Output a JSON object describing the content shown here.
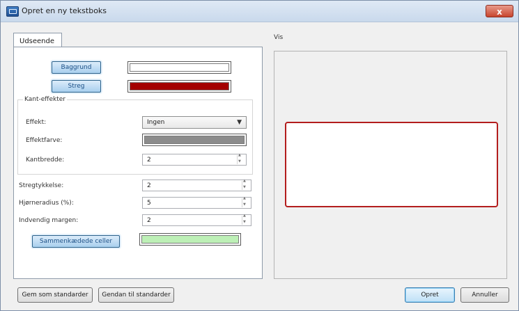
{
  "window": {
    "title": "Opret en ny tekstboks",
    "close_label": "x"
  },
  "tabs": {
    "appearance_label": "Udseende"
  },
  "appearance": {
    "background_button": "Baggrund",
    "stroke_button": "Streg",
    "background_color": "#ffffff",
    "stroke_color": "#a40000",
    "edge_effects": {
      "group_label": "Kant-effekter",
      "effect_label": "Effekt:",
      "effect_value": "Ingen",
      "effect_color_label": "Effektfarve:",
      "effect_color": "#8c8c8c",
      "edge_width_label": "Kantbredde:",
      "edge_width_value": "2"
    },
    "stroke_thickness_label": "Stregtykkelse:",
    "stroke_thickness_value": "2",
    "corner_radius_label": "Hjørneradius (%):",
    "corner_radius_value": "5",
    "inner_margin_label": "Indvendig margen:",
    "inner_margin_value": "2",
    "linked_cells_button": "Sammenkædede celler",
    "linked_cells_color": "#bdf0b6"
  },
  "preview": {
    "label": "Vis",
    "border_color": "#b31d1d"
  },
  "footer": {
    "save_defaults": "Gem som standarder",
    "restore_defaults": "Gendan til standarder",
    "create": "Opret",
    "cancel": "Annuller"
  }
}
